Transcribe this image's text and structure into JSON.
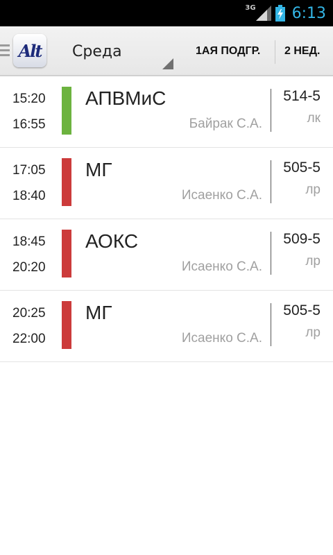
{
  "status_bar": {
    "network": "3G",
    "time": "6:13",
    "time_color": "#33b5e5",
    "icons": [
      "signal-icon",
      "battery-charging-icon"
    ]
  },
  "action_bar": {
    "logo_text": " Alt",
    "day": "Среда",
    "subgroup_label": "1АЯ ПОДГР.",
    "week_label": "2 НЕД."
  },
  "colors": {
    "green": "#6cb33f",
    "red": "#cc3b3b"
  },
  "lessons": [
    {
      "start": "15:20",
      "end": "16:55",
      "subject": "АПВМиС",
      "teacher": "Байрак С.А.",
      "room": "514-5",
      "type": "лк",
      "color": "#6cb33f"
    },
    {
      "start": "17:05",
      "end": "18:40",
      "subject": "МГ",
      "teacher": "Исаенко С.А.",
      "room": "505-5",
      "type": "лр",
      "color": "#cc3b3b"
    },
    {
      "start": "18:45",
      "end": "20:20",
      "subject": "АОКС",
      "teacher": "Исаенко С.А.",
      "room": "509-5",
      "type": "лр",
      "color": "#cc3b3b"
    },
    {
      "start": "20:25",
      "end": "22:00",
      "subject": "МГ",
      "teacher": "Исаенко С.А.",
      "room": "505-5",
      "type": "лр",
      "color": "#cc3b3b"
    }
  ]
}
